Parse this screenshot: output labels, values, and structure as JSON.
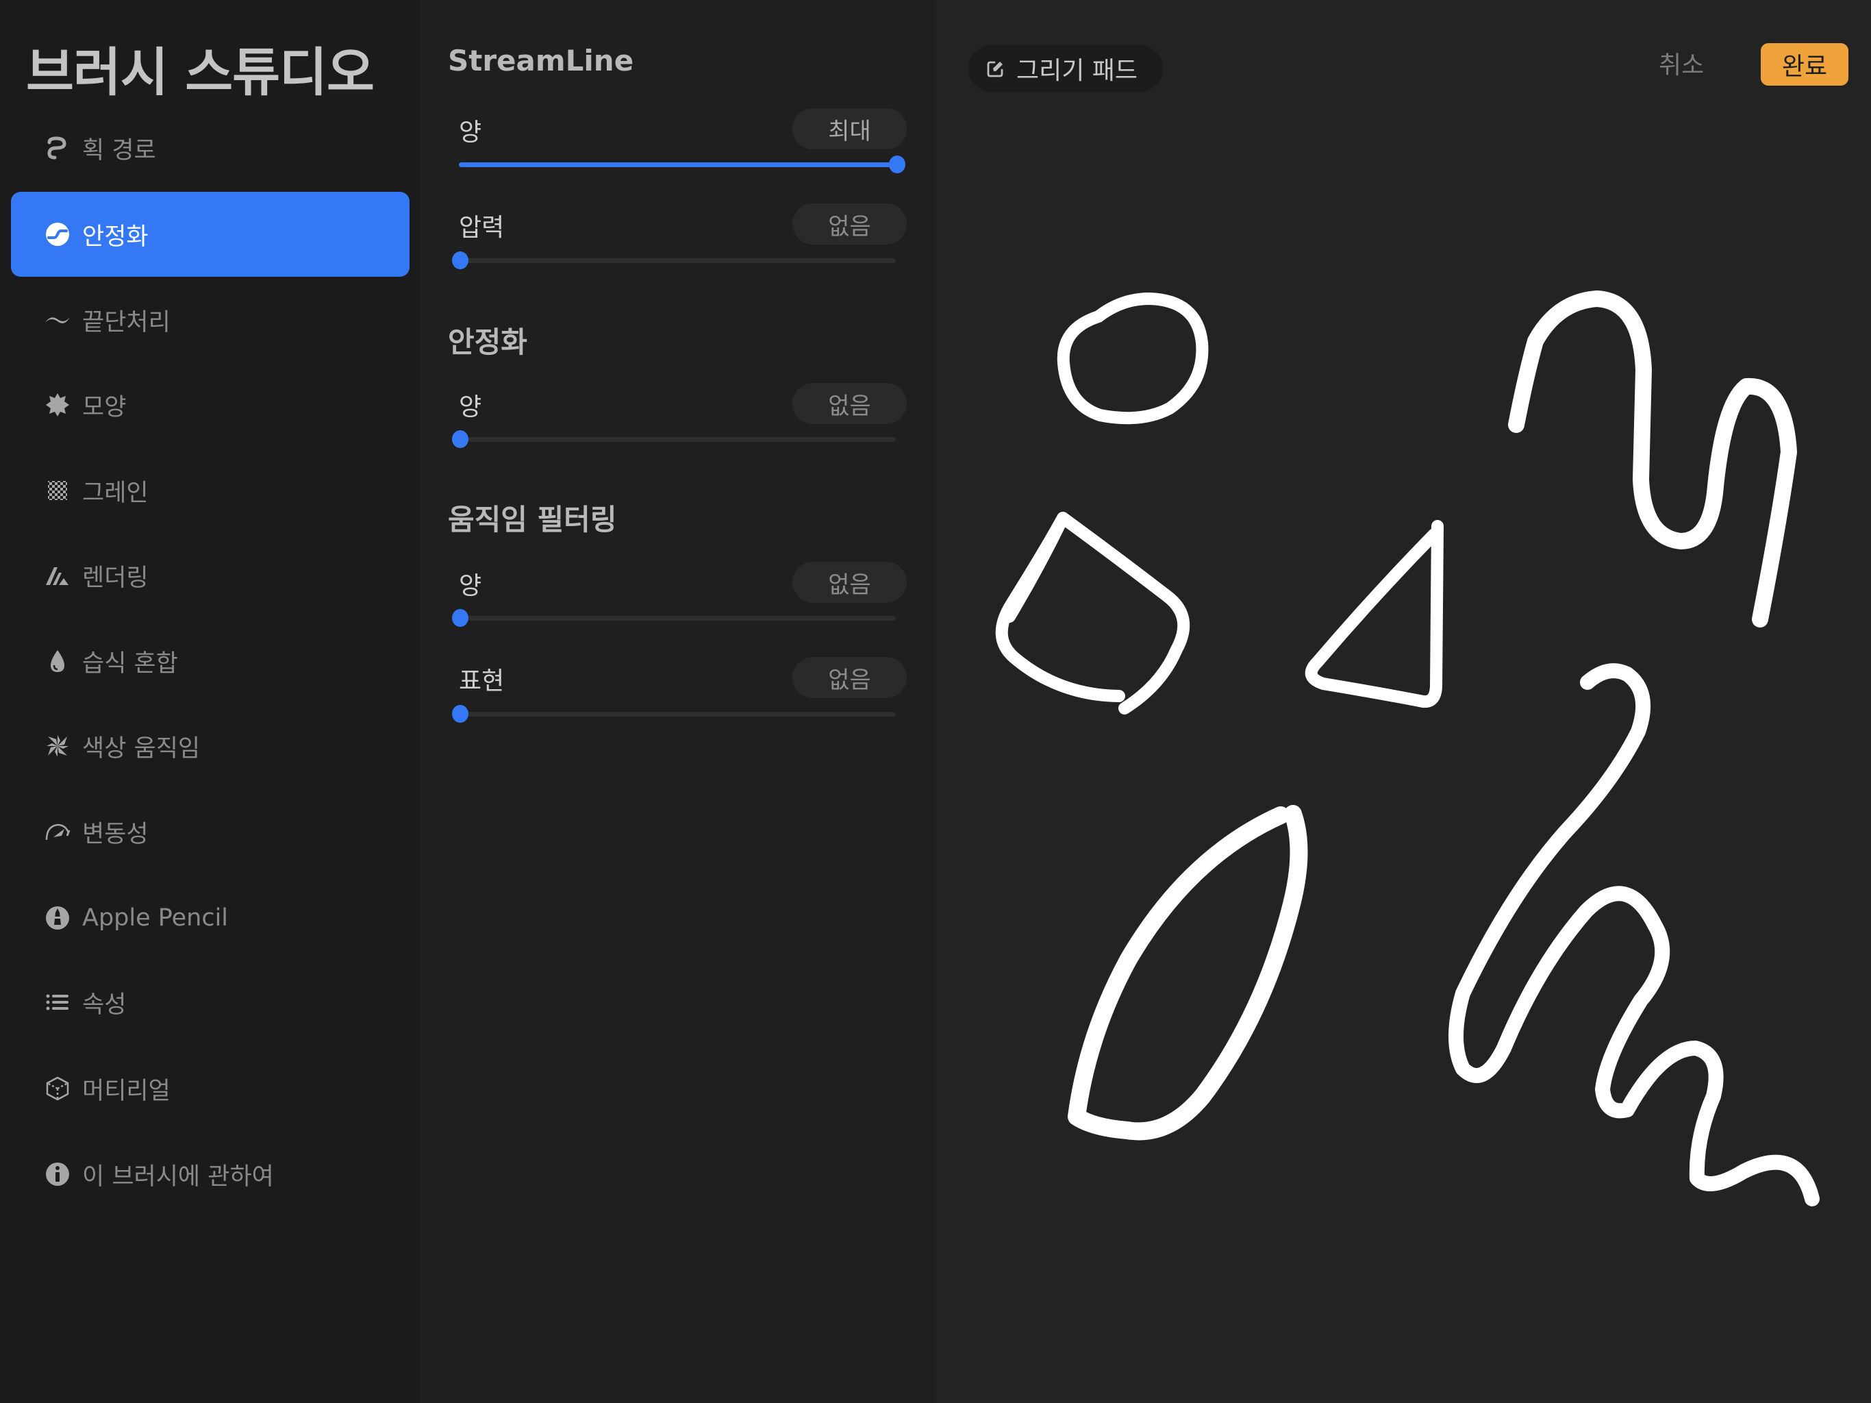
{
  "sidebar": {
    "title": "브러시 스튜디오",
    "active_index": 1,
    "items": [
      {
        "label": "획 경로",
        "icon": "stroke-path-icon"
      },
      {
        "label": "안정화",
        "icon": "stabilization-icon"
      },
      {
        "label": "끝단처리",
        "icon": "taper-icon"
      },
      {
        "label": "모양",
        "icon": "shape-icon"
      },
      {
        "label": "그레인",
        "icon": "grain-icon"
      },
      {
        "label": "렌더링",
        "icon": "rendering-icon"
      },
      {
        "label": "습식 혼합",
        "icon": "wet-mix-icon"
      },
      {
        "label": "색상 움직임",
        "icon": "color-dynamics-icon"
      },
      {
        "label": "변동성",
        "icon": "dynamics-icon"
      },
      {
        "label": "Apple Pencil",
        "icon": "apple-pencil-icon"
      },
      {
        "label": "속성",
        "icon": "properties-icon"
      },
      {
        "label": "머티리얼",
        "icon": "materials-icon"
      },
      {
        "label": "이 브러시에 관하여",
        "icon": "info-icon"
      }
    ]
  },
  "settings": {
    "sections": [
      {
        "title": "StreamLine",
        "rows": [
          {
            "label": "양",
            "value_label": "최대",
            "value": 1.0
          },
          {
            "label": "압력",
            "value_label": "없음",
            "value": 0.0
          }
        ]
      },
      {
        "title": "안정화",
        "rows": [
          {
            "label": "양",
            "value_label": "없음",
            "value": 0.0
          }
        ]
      },
      {
        "title": "움직임 필터링",
        "rows": [
          {
            "label": "양",
            "value_label": "없음",
            "value": 0.0
          },
          {
            "label": "표현",
            "value_label": "없음",
            "value": 0.0
          }
        ]
      }
    ]
  },
  "canvas": {
    "pad_label": "그리기 패드",
    "cancel_label": "취소",
    "done_label": "완료"
  },
  "colors": {
    "accent": "#3478f6",
    "done_button": "#f0a23b",
    "stroke": "#ffffff"
  }
}
